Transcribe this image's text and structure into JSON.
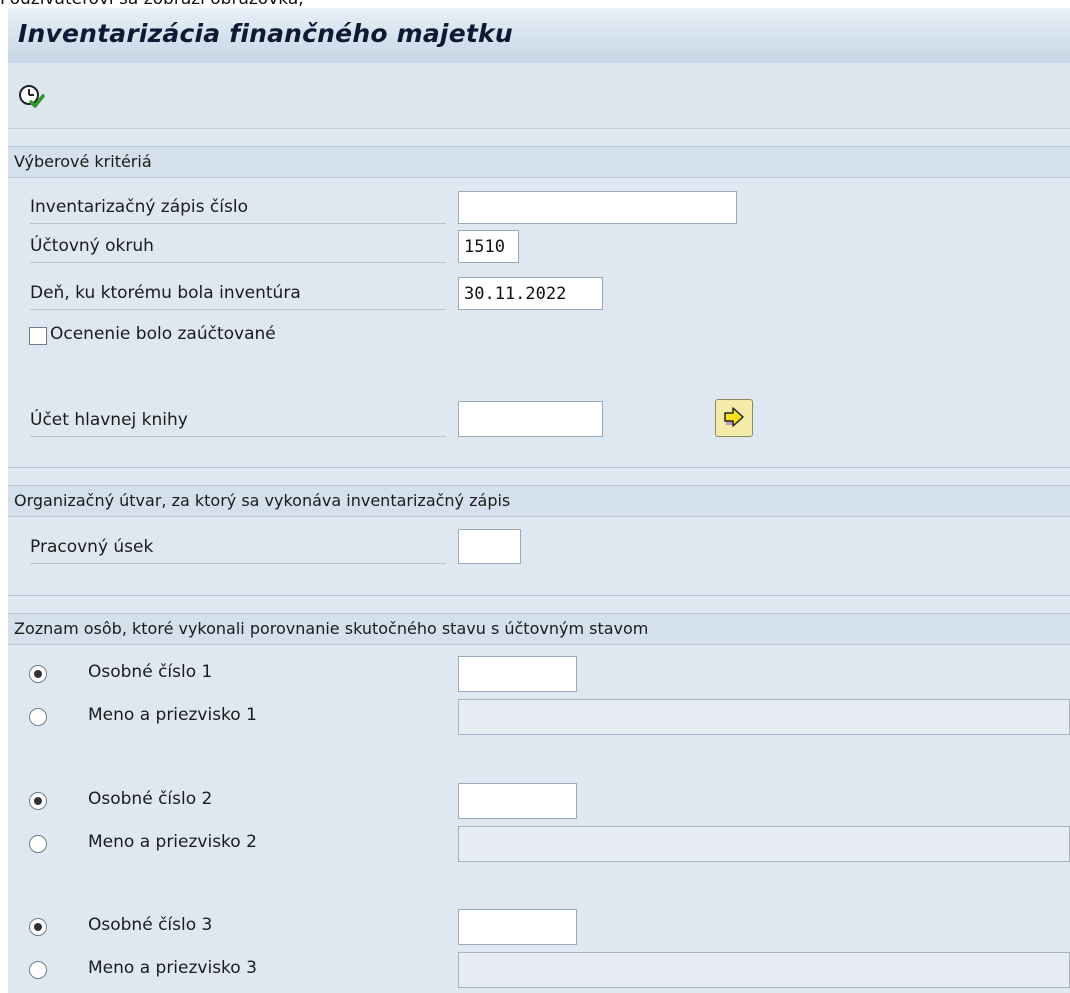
{
  "page": {
    "caption": "Používateľovi sa zobrazí obrazovka,",
    "title": "Inventarizácia finančného majetku"
  },
  "toolbar": {
    "execute_icon": "execute-clock-check-icon"
  },
  "selection": {
    "header": "Výberové kritériá",
    "inventory_number": {
      "label": "Inventarizačný zápis číslo",
      "value": ""
    },
    "company_code": {
      "label": "Účtovný okruh",
      "value": "1510"
    },
    "inventory_date": {
      "label": "Deň, ku ktorému bola inventúra",
      "value": "30.11.2022"
    },
    "posted_checkbox": {
      "label": "Ocenenie bolo zaúčtované",
      "checked": false
    },
    "gl_account": {
      "label": "Účet hlavnej knihy",
      "value": "",
      "multiple_selection_icon": "arrow-right-icon"
    }
  },
  "org_unit": {
    "header": "Organizačný útvar, za ktorý sa vykonáva inventarizačný zápis",
    "work_section": {
      "label": "Pracovný úsek",
      "value": ""
    }
  },
  "persons": {
    "header": "Zoznam osôb, ktoré vykonali porovnanie skutočného stavu s účtovným stavom",
    "entries": [
      {
        "personal_label": "Osobné číslo 1",
        "name_label": "Meno a priezvisko 1",
        "selected": "personal",
        "personal_value": "",
        "name_value": ""
      },
      {
        "personal_label": "Osobné číslo 2",
        "name_label": "Meno a priezvisko 2",
        "selected": "personal",
        "personal_value": "",
        "name_value": ""
      },
      {
        "personal_label": "Osobné číslo 3",
        "name_label": "Meno a priezvisko 3",
        "selected": "personal",
        "personal_value": "",
        "name_value": ""
      }
    ]
  },
  "colors": {
    "background": "#dfe8f1",
    "section_header": "#d4e0ec",
    "nav_button": "#f4eba9"
  }
}
